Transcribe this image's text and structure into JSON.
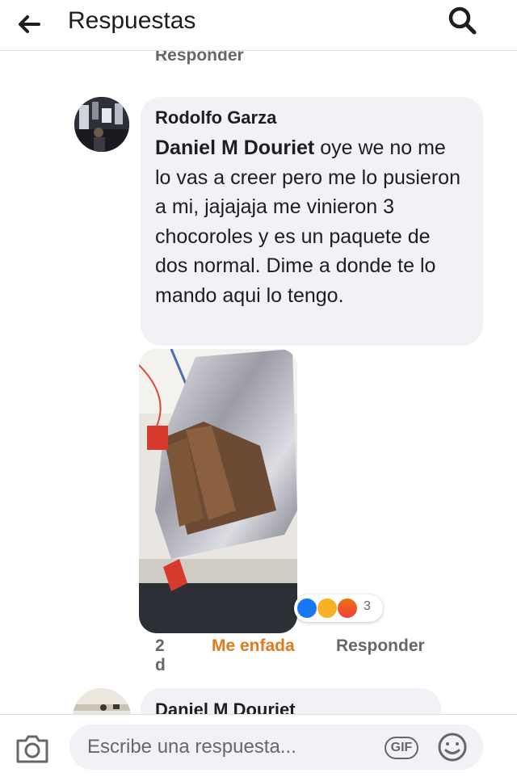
{
  "header": {
    "title": "Respuestas"
  },
  "previous": {
    "reply_label": "Responder"
  },
  "comment": {
    "author": "Rodolfo Garza",
    "mention": "Daniel M Douriet",
    "text": " oye we no me lo vas a creer pero me lo pusieron a mi, jajajaja me vinieron 3 chocoroles y es un paquete de dos normal. Dime a donde te lo mando aqui lo tengo.",
    "reaction_count": "3",
    "reactions": [
      "like-icon",
      "haha-icon",
      "angry-icon"
    ],
    "time": "2 d",
    "reaction_label": "Me enfada",
    "reply_label": "Responder",
    "reaction_color": "#e17a1e"
  },
  "next_comment": {
    "author": "Daniel M Douriet"
  },
  "composer": {
    "placeholder": "Escribe una respuesta...",
    "gif_label": "GIF"
  }
}
